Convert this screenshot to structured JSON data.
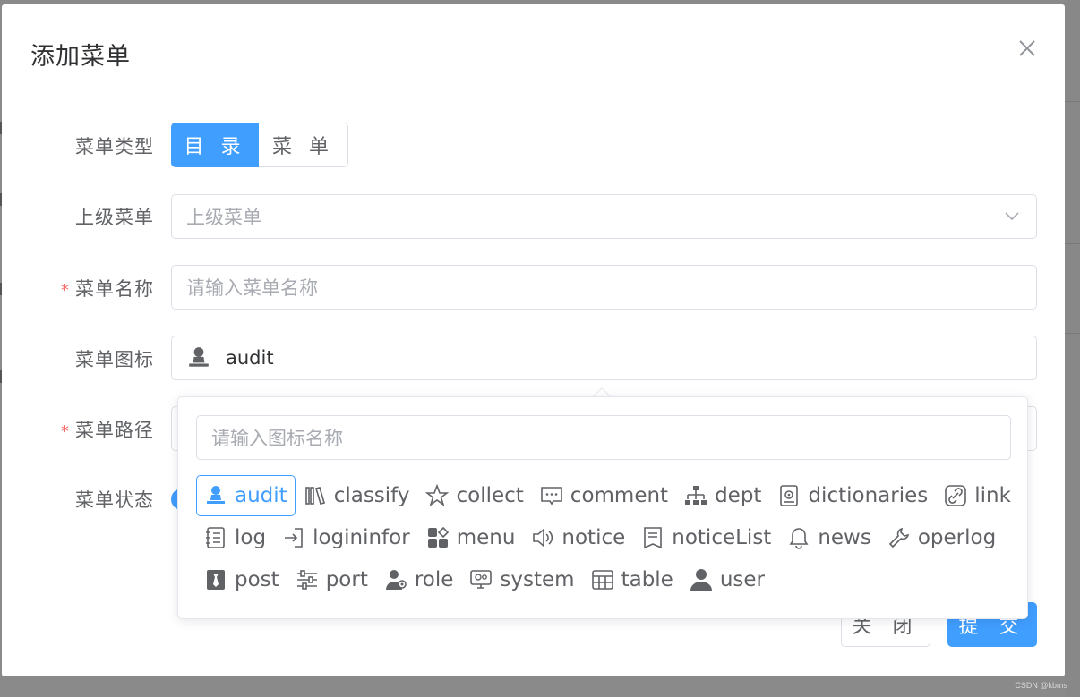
{
  "dialog": {
    "title": "添加菜单"
  },
  "form": {
    "menu_type": {
      "label": "菜单类型",
      "options": [
        "目 录",
        "菜 单"
      ],
      "selected": "目 录"
    },
    "parent_menu": {
      "label": "上级菜单",
      "placeholder": "上级菜单"
    },
    "menu_name": {
      "label": "菜单名称",
      "required_mark": "*",
      "placeholder": "请输入菜单名称"
    },
    "menu_icon": {
      "label": "菜单图标",
      "value": "audit"
    },
    "menu_path": {
      "label": "菜单路径",
      "required_mark": "*"
    },
    "menu_status": {
      "label": "菜单状态"
    }
  },
  "icon_picker": {
    "search_placeholder": "请输入图标名称",
    "selected": "audit",
    "rows": [
      [
        "audit",
        "classify",
        "collect",
        "comment",
        "dept",
        "dictionaries",
        "link"
      ],
      [
        "log",
        "logininfor",
        "menu",
        "notice",
        "noticeList",
        "news",
        "operlog"
      ],
      [
        "post",
        "port",
        "role",
        "system",
        "table",
        "user"
      ]
    ]
  },
  "footer": {
    "close_label": "关 闭",
    "submit_label": "提 交"
  },
  "watermark": "CSDN @kbms",
  "colors": {
    "primary": "#409eff",
    "required": "#f56c6c",
    "text": "#606266",
    "placeholder": "#a8abb2",
    "border": "#dcdfe6"
  }
}
